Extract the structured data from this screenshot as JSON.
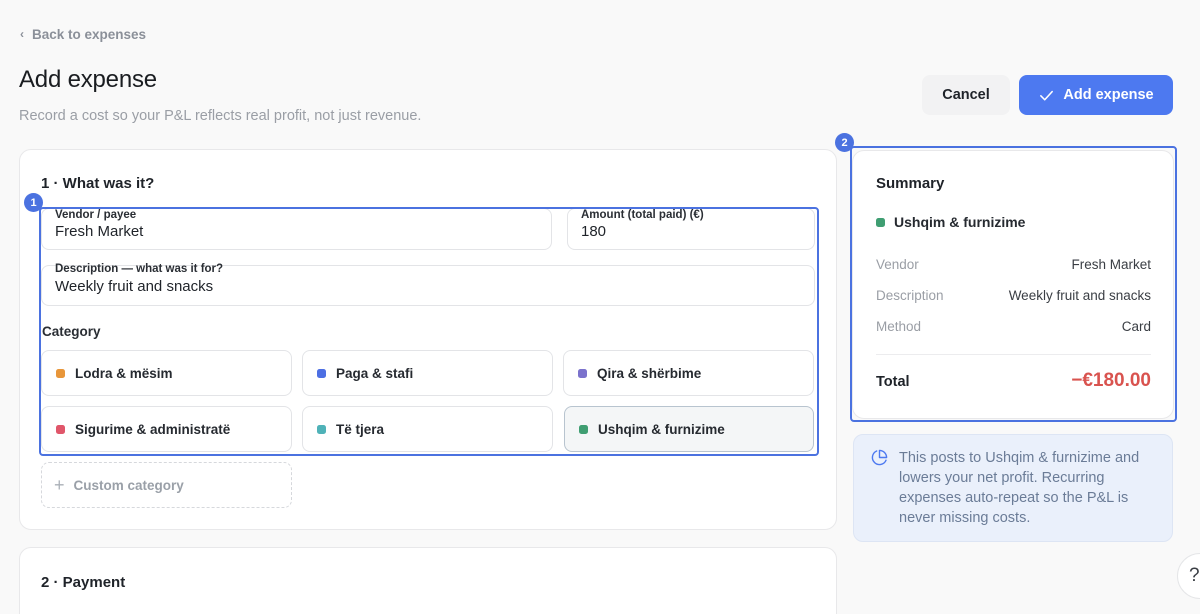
{
  "nav": {
    "back_label": "Back to expenses"
  },
  "header": {
    "title": "Add expense",
    "subtitle": "Record a cost so your P&L reflects real profit, not just revenue.",
    "cancel_label": "Cancel",
    "add_label": "Add expense"
  },
  "what_section": {
    "title": "1 · What was it?",
    "vendor": {
      "label": "Vendor / payee",
      "value": "Fresh Market"
    },
    "amount": {
      "label": "Amount (total paid) (€)",
      "value": "180"
    },
    "description": {
      "label": "Description — what was it for?",
      "value": "Weekly fruit and snacks"
    },
    "category_label": "Category",
    "categories": [
      {
        "label": "Lodra & mësim",
        "color": "#e8963a",
        "selected": false
      },
      {
        "label": "Paga & stafi",
        "color": "#4d6fe3",
        "selected": false
      },
      {
        "label": "Qira & shërbime",
        "color": "#7b72cc",
        "selected": false
      },
      {
        "label": "Sigurime & administratë",
        "color": "#e0566a",
        "selected": false
      },
      {
        "label": "Të tjera",
        "color": "#4fb2b8",
        "selected": false
      },
      {
        "label": "Ushqim & furnizime",
        "color": "#3f9e72",
        "selected": true
      }
    ],
    "custom_category_label": "Custom category"
  },
  "payment_section": {
    "title": "2 · Payment"
  },
  "markers": {
    "first": "1",
    "second": "2"
  },
  "summary": {
    "title": "Summary",
    "category": "Ushqim & furnizime",
    "category_color": "#3f9e72",
    "rows": [
      {
        "label": "Vendor",
        "value": "Fresh Market"
      },
      {
        "label": "Description",
        "value": "Weekly fruit and snacks"
      },
      {
        "label": "Method",
        "value": "Card"
      }
    ],
    "total_label": "Total",
    "total_value": "−€180.00"
  },
  "info": {
    "text": "This posts to Ushqim & furnizime and lowers your net profit. Recurring expenses auto-repeat so the P&L is never missing costs."
  },
  "help": {
    "glyph": "?"
  },
  "colors": {
    "accent": "#4d79f0",
    "negative": "#d9534f",
    "highlight": "#4b72e0"
  }
}
